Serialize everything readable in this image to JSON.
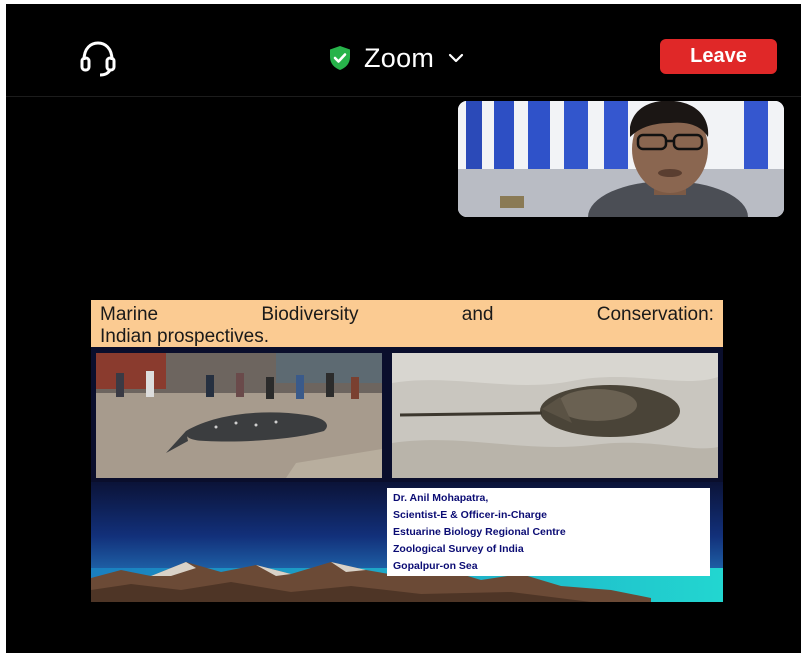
{
  "meeting": {
    "title": "Zoom",
    "leave_label": "Leave"
  },
  "colors": {
    "background": "#000000",
    "leave_button": "#e02828",
    "secure_shield": "#27b34a",
    "slide_title_bg": "#fbcb92",
    "slide_credits_text": "#0b0c74"
  },
  "icons": {
    "audio": "headphones-icon",
    "security": "shield-check-icon",
    "title_menu": "chevron-down-icon"
  },
  "shared_slide": {
    "title_line1_words": [
      "Marine",
      "Biodiversity",
      "and",
      "Conservation:"
    ],
    "title_line2": "Indian prospectives.",
    "credits": [
      "Dr. Anil Mohapatra,",
      "Scientist-E & Officer-in-Charge",
      "Estuarine Biology Regional Centre",
      "Zoological Survey of India",
      "Gopalpur-on Sea"
    ]
  }
}
